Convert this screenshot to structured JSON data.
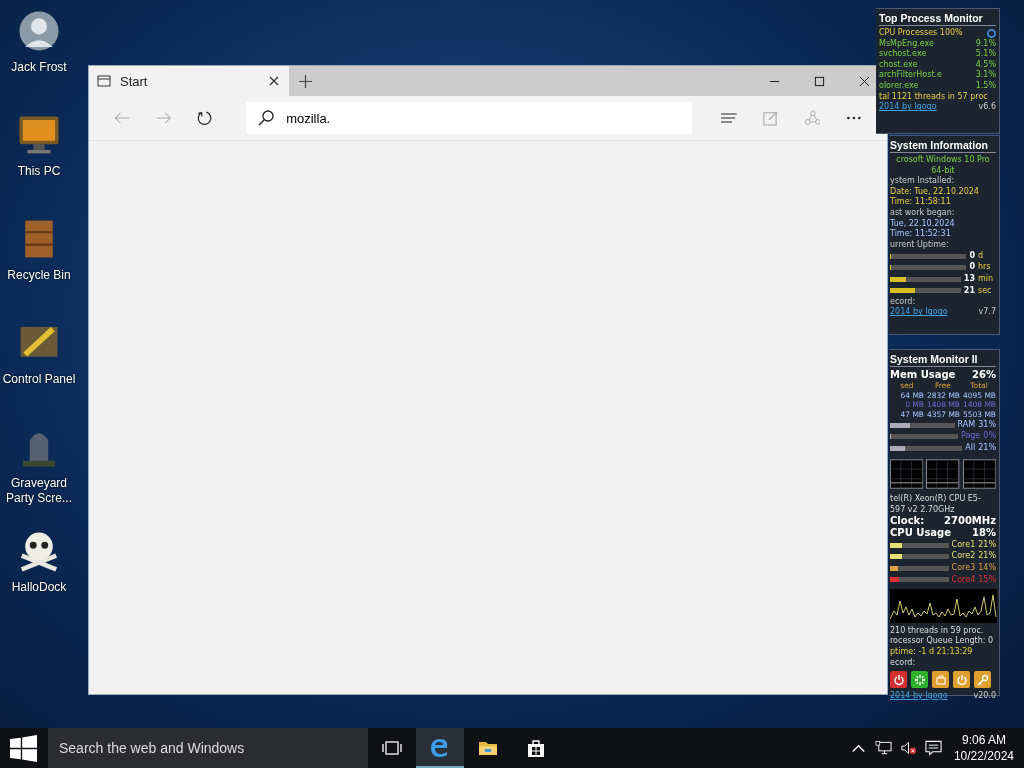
{
  "desktop_icons": [
    {
      "label": "Jack Frost",
      "kind": "avatar"
    },
    {
      "label": "This PC",
      "kind": "monitor"
    },
    {
      "label": "Recycle Bin",
      "kind": "bin"
    },
    {
      "label": "Control Panel",
      "kind": "tools"
    },
    {
      "label": "Graveyard Party Scre...",
      "kind": "tombstone"
    },
    {
      "label": "HalloDock",
      "kind": "skull"
    }
  ],
  "browser": {
    "tabs": [
      {
        "label": "Start",
        "selected": true
      }
    ],
    "address": "mozilla."
  },
  "top_process_monitor": {
    "title": "Top Process Monitor",
    "header": "CPU Processes 100%",
    "processes": [
      {
        "name": "MsMpEng.exe",
        "cpu": "9.1%"
      },
      {
        "name": "svchost.exe",
        "cpu": "5.1%"
      },
      {
        "name": "chost.exe",
        "cpu": "4.5%"
      },
      {
        "name": "archFilterHost.e",
        "cpu": "3.1%"
      },
      {
        "name": "olorer.exe",
        "cpu": "1.5%"
      }
    ],
    "summary": "tal 1121 threads in 57 proc",
    "link": "2014 by Igogo",
    "version": "v6.6"
  },
  "system_information": {
    "title": "System Information",
    "lines": [
      {
        "text": "crosoft Windows 10 Pro",
        "kind": "os"
      },
      {
        "text": "64-bit",
        "kind": "os"
      },
      {
        "text": "ystem Installed:",
        "kind": "label"
      },
      {
        "text": "Date: Tue, 22.10.2024",
        "kind": "value"
      },
      {
        "text": "Time: 11:58:11",
        "kind": "value"
      },
      {
        "text": "ast work began:",
        "kind": "label"
      },
      {
        "text": "Tue, 22.10.2024",
        "kind": "info"
      },
      {
        "text": "Time: 11:52:31",
        "kind": "info"
      },
      {
        "text": "urrent Uptime:",
        "kind": "label"
      }
    ],
    "uptime": [
      {
        "value": "0",
        "unit": "d",
        "level": 0
      },
      {
        "value": "0",
        "unit": "hrs",
        "level": 0
      },
      {
        "value": "13",
        "unit": "min",
        "level": 0.22
      },
      {
        "value": "21",
        "unit": "sec",
        "level": 0.35
      }
    ],
    "record_label": "ecord:",
    "link": "2014 by Igogo",
    "version": "v7.7"
  },
  "system_monitor": {
    "title": "System Monitor II",
    "mem_title": "Mem Usage",
    "mem_percent": "26%",
    "columns": [
      "sed",
      "Free",
      "Total"
    ],
    "rows": [
      [
        "64 MB",
        "2832 MB",
        "4095 MB"
      ],
      [
        "0 MB",
        "1408 MB",
        "1408 MB"
      ],
      [
        "47 MB",
        "4357 MB",
        "5503 MB"
      ]
    ],
    "meters": [
      {
        "label": "RAM",
        "value": "31%",
        "level": 0.31
      },
      {
        "label": "Page",
        "value": "0%",
        "level": 0
      },
      {
        "label": "All",
        "value": "21%",
        "level": 0.21
      }
    ],
    "cpu_name": "tel(R) Xeon(R) CPU E5-597 v2 2.70GHz",
    "clock_label": "Clock:",
    "clock": "2700MHz",
    "cpu_title": "CPU Usage",
    "cpu_percent": "18%",
    "cores": [
      {
        "label": "Core1",
        "value": "21%",
        "level": 0.21,
        "color": "#e8e070"
      },
      {
        "label": "Core2",
        "value": "21%",
        "level": 0.21,
        "color": "#e8e070"
      },
      {
        "label": "Core3",
        "value": "14%",
        "level": 0.14,
        "color": "#e0a040"
      },
      {
        "label": "Core4",
        "value": "15%",
        "level": 0.15,
        "color": "#e03030"
      }
    ],
    "threads": "210 threads in 59 proc.",
    "queue": "rocessor Queue Length: 0",
    "uptime": "ptime: -1 d 21:13:29",
    "record_label": "ecord:",
    "buttons": [
      {
        "kind": "power",
        "color": "#d03030"
      },
      {
        "kind": "sun",
        "color": "#30b030"
      },
      {
        "kind": "logoff",
        "color": "#e0a030"
      },
      {
        "kind": "sleep",
        "color": "#e0a030"
      },
      {
        "kind": "key",
        "color": "#e0a030"
      }
    ],
    "link": "2014 by Igogo",
    "version": "v20.0"
  },
  "taskbar": {
    "search": {
      "placeholder": "Search the web and Windows"
    },
    "apps": [
      {
        "kind": "taskview",
        "active": false
      },
      {
        "kind": "edge",
        "active": true
      },
      {
        "kind": "explorer",
        "active": false
      },
      {
        "kind": "store",
        "active": false
      }
    ],
    "time": "9:06 AM",
    "date": "10/22/2024"
  }
}
